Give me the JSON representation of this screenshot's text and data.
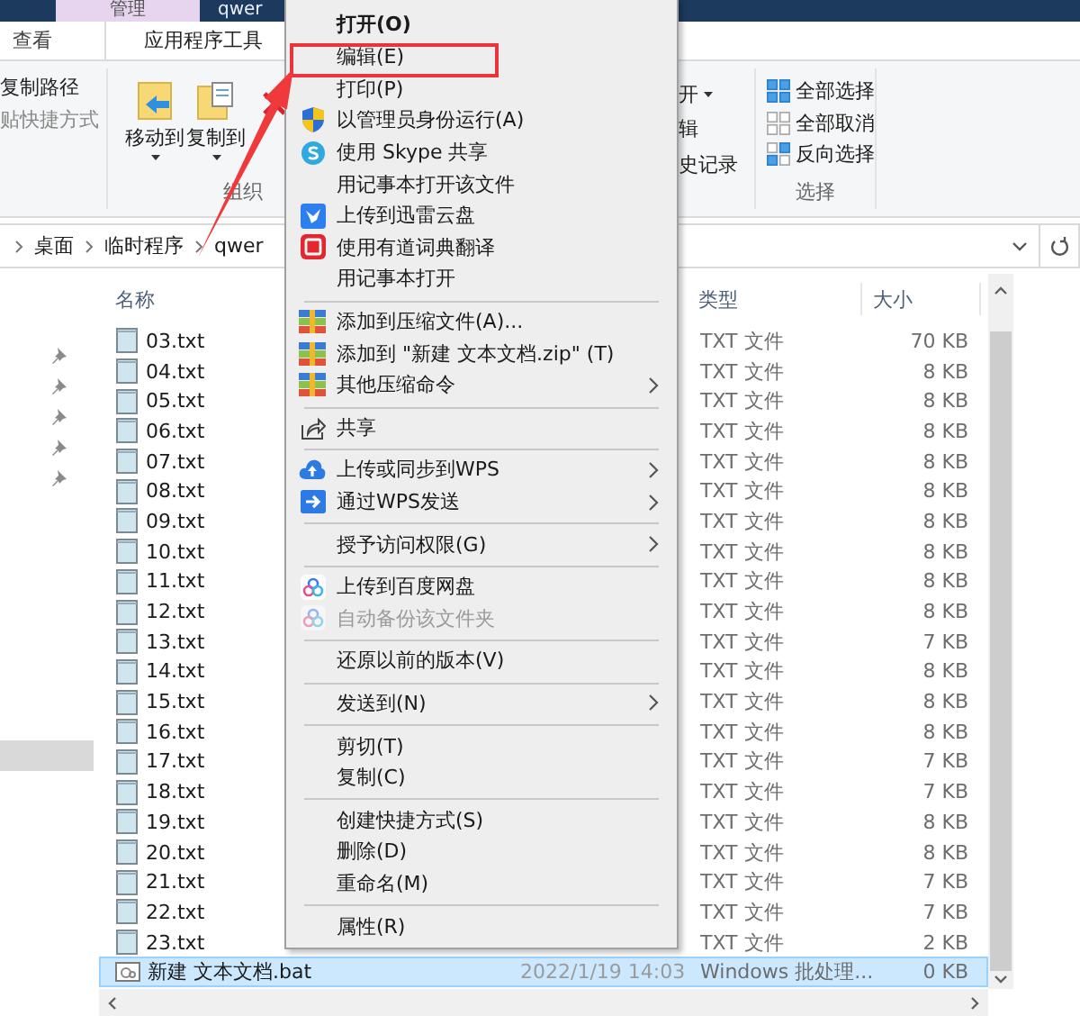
{
  "title_bar": {
    "context_tab": "管理",
    "folder_name": "qwer"
  },
  "ribbon_tabs": [
    {
      "label": "查看",
      "selected": false
    },
    {
      "label": "应用程序工具",
      "selected": true
    }
  ],
  "ribbon": {
    "clipboard": [
      "复制路径",
      "贴快捷方式"
    ],
    "organize": {
      "buttons": [
        {
          "label": "移动到",
          "kind": "move"
        },
        {
          "label": "复制到",
          "kind": "copy"
        }
      ],
      "label": "组织"
    },
    "open": [
      "开",
      "辑",
      "史记录"
    ],
    "select": {
      "items": [
        {
          "label": "全部选择",
          "kind": "all"
        },
        {
          "label": "全部取消",
          "kind": "none"
        },
        {
          "label": "反向选择",
          "kind": "invert"
        }
      ],
      "label": "选择"
    }
  },
  "address": [
    "桌面",
    "临时程序",
    "qwer"
  ],
  "file_list": {
    "columns": [
      "名称",
      "类型",
      "大小"
    ],
    "rows": [
      {
        "name": "03.txt",
        "type": "TXT 文件",
        "size": "70 KB",
        "kind": "text",
        "selected": false
      },
      {
        "name": "04.txt",
        "type": "TXT 文件",
        "size": "8 KB",
        "kind": "text",
        "selected": false
      },
      {
        "name": "05.txt",
        "type": "TXT 文件",
        "size": "8 KB",
        "kind": "text",
        "selected": false
      },
      {
        "name": "06.txt",
        "type": "TXT 文件",
        "size": "8 KB",
        "kind": "text",
        "selected": false
      },
      {
        "name": "07.txt",
        "type": "TXT 文件",
        "size": "8 KB",
        "kind": "text",
        "selected": false
      },
      {
        "name": "08.txt",
        "type": "TXT 文件",
        "size": "8 KB",
        "kind": "text",
        "selected": false
      },
      {
        "name": "09.txt",
        "type": "TXT 文件",
        "size": "8 KB",
        "kind": "text",
        "selected": false
      },
      {
        "name": "10.txt",
        "type": "TXT 文件",
        "size": "8 KB",
        "kind": "text",
        "selected": false
      },
      {
        "name": "11.txt",
        "type": "TXT 文件",
        "size": "8 KB",
        "kind": "text",
        "selected": false
      },
      {
        "name": "12.txt",
        "type": "TXT 文件",
        "size": "8 KB",
        "kind": "text",
        "selected": false
      },
      {
        "name": "13.txt",
        "type": "TXT 文件",
        "size": "7 KB",
        "kind": "text",
        "selected": false
      },
      {
        "name": "14.txt",
        "type": "TXT 文件",
        "size": "8 KB",
        "kind": "text",
        "selected": false
      },
      {
        "name": "15.txt",
        "type": "TXT 文件",
        "size": "8 KB",
        "kind": "text",
        "selected": false
      },
      {
        "name": "16.txt",
        "type": "TXT 文件",
        "size": "8 KB",
        "kind": "text",
        "selected": false
      },
      {
        "name": "17.txt",
        "type": "TXT 文件",
        "size": "7 KB",
        "kind": "text",
        "selected": false
      },
      {
        "name": "18.txt",
        "type": "TXT 文件",
        "size": "7 KB",
        "kind": "text",
        "selected": false
      },
      {
        "name": "19.txt",
        "type": "TXT 文件",
        "size": "8 KB",
        "kind": "text",
        "selected": false
      },
      {
        "name": "20.txt",
        "type": "TXT 文件",
        "size": "8 KB",
        "kind": "text",
        "selected": false
      },
      {
        "name": "21.txt",
        "type": "TXT 文件",
        "size": "7 KB",
        "kind": "text",
        "selected": false
      },
      {
        "name": "22.txt",
        "type": "TXT 文件",
        "size": "7 KB",
        "kind": "text",
        "selected": false
      },
      {
        "name": "23.txt",
        "type": "TXT 文件",
        "size": "2 KB",
        "kind": "text",
        "selected": false
      },
      {
        "name": "新建 文本文档.bat",
        "date": "2022/1/19 14:03",
        "type": "Windows 批处理...",
        "size": "0 KB",
        "kind": "batch",
        "selected": true
      }
    ]
  },
  "context_menu": {
    "default_item": "打开(O)",
    "groups": [
      [
        {
          "label": "编辑(E)",
          "kind": "plain",
          "submenu": false,
          "disabled": false,
          "highlighted": true
        },
        {
          "label": "打印(P)",
          "kind": "plain",
          "submenu": false,
          "disabled": false,
          "highlighted": false
        },
        {
          "label": "以管理员身份运行(A)",
          "kind": "shield",
          "submenu": false,
          "disabled": false,
          "highlighted": false
        },
        {
          "label": "使用 Skype 共享",
          "kind": "skype",
          "submenu": false,
          "disabled": false,
          "highlighted": false
        },
        {
          "label": "用记事本打开该文件",
          "kind": "plain",
          "submenu": false,
          "disabled": false,
          "highlighted": false
        },
        {
          "label": "上传到迅雷云盘",
          "kind": "bird",
          "submenu": false,
          "disabled": false,
          "highlighted": false
        },
        {
          "label": "使用有道词典翻译",
          "kind": "dictionary",
          "submenu": false,
          "disabled": false,
          "highlighted": false
        },
        {
          "label": "用记事本打开",
          "kind": "plain",
          "submenu": false,
          "disabled": false,
          "highlighted": false
        }
      ],
      [
        {
          "label": "添加到压缩文件(A)...",
          "kind": "archive",
          "submenu": false,
          "disabled": false,
          "highlighted": false
        },
        {
          "label": "添加到 \"新建 文本文档.zip\" (T)",
          "kind": "archive",
          "submenu": false,
          "disabled": false,
          "highlighted": false
        },
        {
          "label": "其他压缩命令",
          "kind": "archive",
          "submenu": true,
          "disabled": false,
          "highlighted": false
        }
      ],
      [
        {
          "label": "共享",
          "kind": "share",
          "submenu": false,
          "disabled": false,
          "highlighted": false
        }
      ],
      [
        {
          "label": "上传或同步到WPS",
          "kind": "cloud",
          "submenu": true,
          "disabled": false,
          "highlighted": false
        },
        {
          "label": "通过WPS发送",
          "kind": "send",
          "submenu": true,
          "disabled": false,
          "highlighted": false
        }
      ],
      [
        {
          "label": "授予访问权限(G)",
          "kind": "plain",
          "submenu": true,
          "disabled": false,
          "highlighted": false
        }
      ],
      [
        {
          "label": "上传到百度网盘",
          "kind": "rings",
          "submenu": false,
          "disabled": false,
          "highlighted": false
        },
        {
          "label": "自动备份该文件夹",
          "kind": "rings",
          "submenu": false,
          "disabled": true,
          "highlighted": false
        }
      ],
      [
        {
          "label": "还原以前的版本(V)",
          "kind": "plain",
          "submenu": false,
          "disabled": false,
          "highlighted": false
        }
      ],
      [
        {
          "label": "发送到(N)",
          "kind": "plain",
          "submenu": true,
          "disabled": false,
          "highlighted": false
        }
      ],
      [
        {
          "label": "剪切(T)",
          "kind": "plain",
          "submenu": false,
          "disabled": false,
          "highlighted": false
        },
        {
          "label": "复制(C)",
          "kind": "plain",
          "submenu": false,
          "disabled": false,
          "highlighted": false
        }
      ],
      [
        {
          "label": "创建快捷方式(S)",
          "kind": "plain",
          "submenu": false,
          "disabled": false,
          "highlighted": false
        },
        {
          "label": "删除(D)",
          "kind": "plain",
          "submenu": false,
          "disabled": false,
          "highlighted": false
        },
        {
          "label": "重命名(M)",
          "kind": "plain",
          "submenu": false,
          "disabled": false,
          "highlighted": false
        }
      ],
      [
        {
          "label": "属性(R)",
          "kind": "plain",
          "submenu": false,
          "disabled": false,
          "highlighted": false
        }
      ]
    ]
  }
}
